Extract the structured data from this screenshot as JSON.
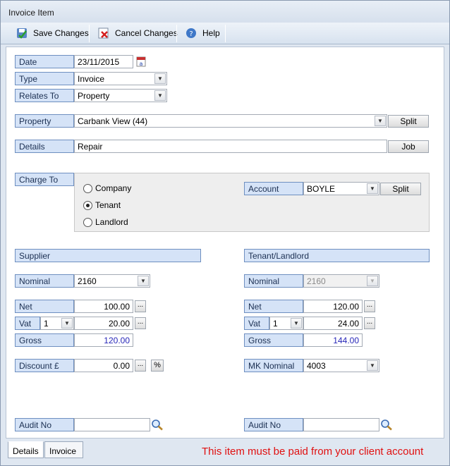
{
  "window": {
    "title": "Invoice Item"
  },
  "toolbar": {
    "save": "Save Changes",
    "cancel": "Cancel Changes",
    "help": "Help"
  },
  "form": {
    "date": {
      "label": "Date",
      "value": "23/11/2015"
    },
    "type": {
      "label": "Type",
      "value": "Invoice"
    },
    "relates_to": {
      "label": "Relates To",
      "value": "Property"
    },
    "property": {
      "label": "Property",
      "value": "Carbank View (44)",
      "split": "Split"
    },
    "details": {
      "label": "Details",
      "value": "Repair",
      "job": "Job"
    }
  },
  "charge_to": {
    "label": "Charge To",
    "options": [
      "Company",
      "Tenant",
      "Landlord"
    ],
    "selected": "Tenant",
    "account_label": "Account",
    "account_value": "BOYLE",
    "split": "Split"
  },
  "supplier": {
    "header": "Supplier",
    "nominal_label": "Nominal",
    "nominal": "2160",
    "net_label": "Net",
    "net": "100.00",
    "vat_label": "Vat",
    "vat_code": "1",
    "vat": "20.00",
    "gross_label": "Gross",
    "gross": "120.00",
    "discount_label": "Discount £",
    "discount": "0.00",
    "percent": "%",
    "audit_label": "Audit No",
    "audit": ""
  },
  "tenant": {
    "header": "Tenant/Landlord",
    "nominal_label": "Nominal",
    "nominal": "2160",
    "net_label": "Net",
    "net": "120.00",
    "vat_label": "Vat",
    "vat_code": "1",
    "vat": "24.00",
    "gross_label": "Gross",
    "gross": "144.00",
    "mk_label": "MK Nominal",
    "mk_nominal": "4003",
    "audit_label": "Audit No",
    "audit": ""
  },
  "tabs": [
    "Details",
    "Invoice"
  ],
  "message": "This item must be paid from your client account"
}
